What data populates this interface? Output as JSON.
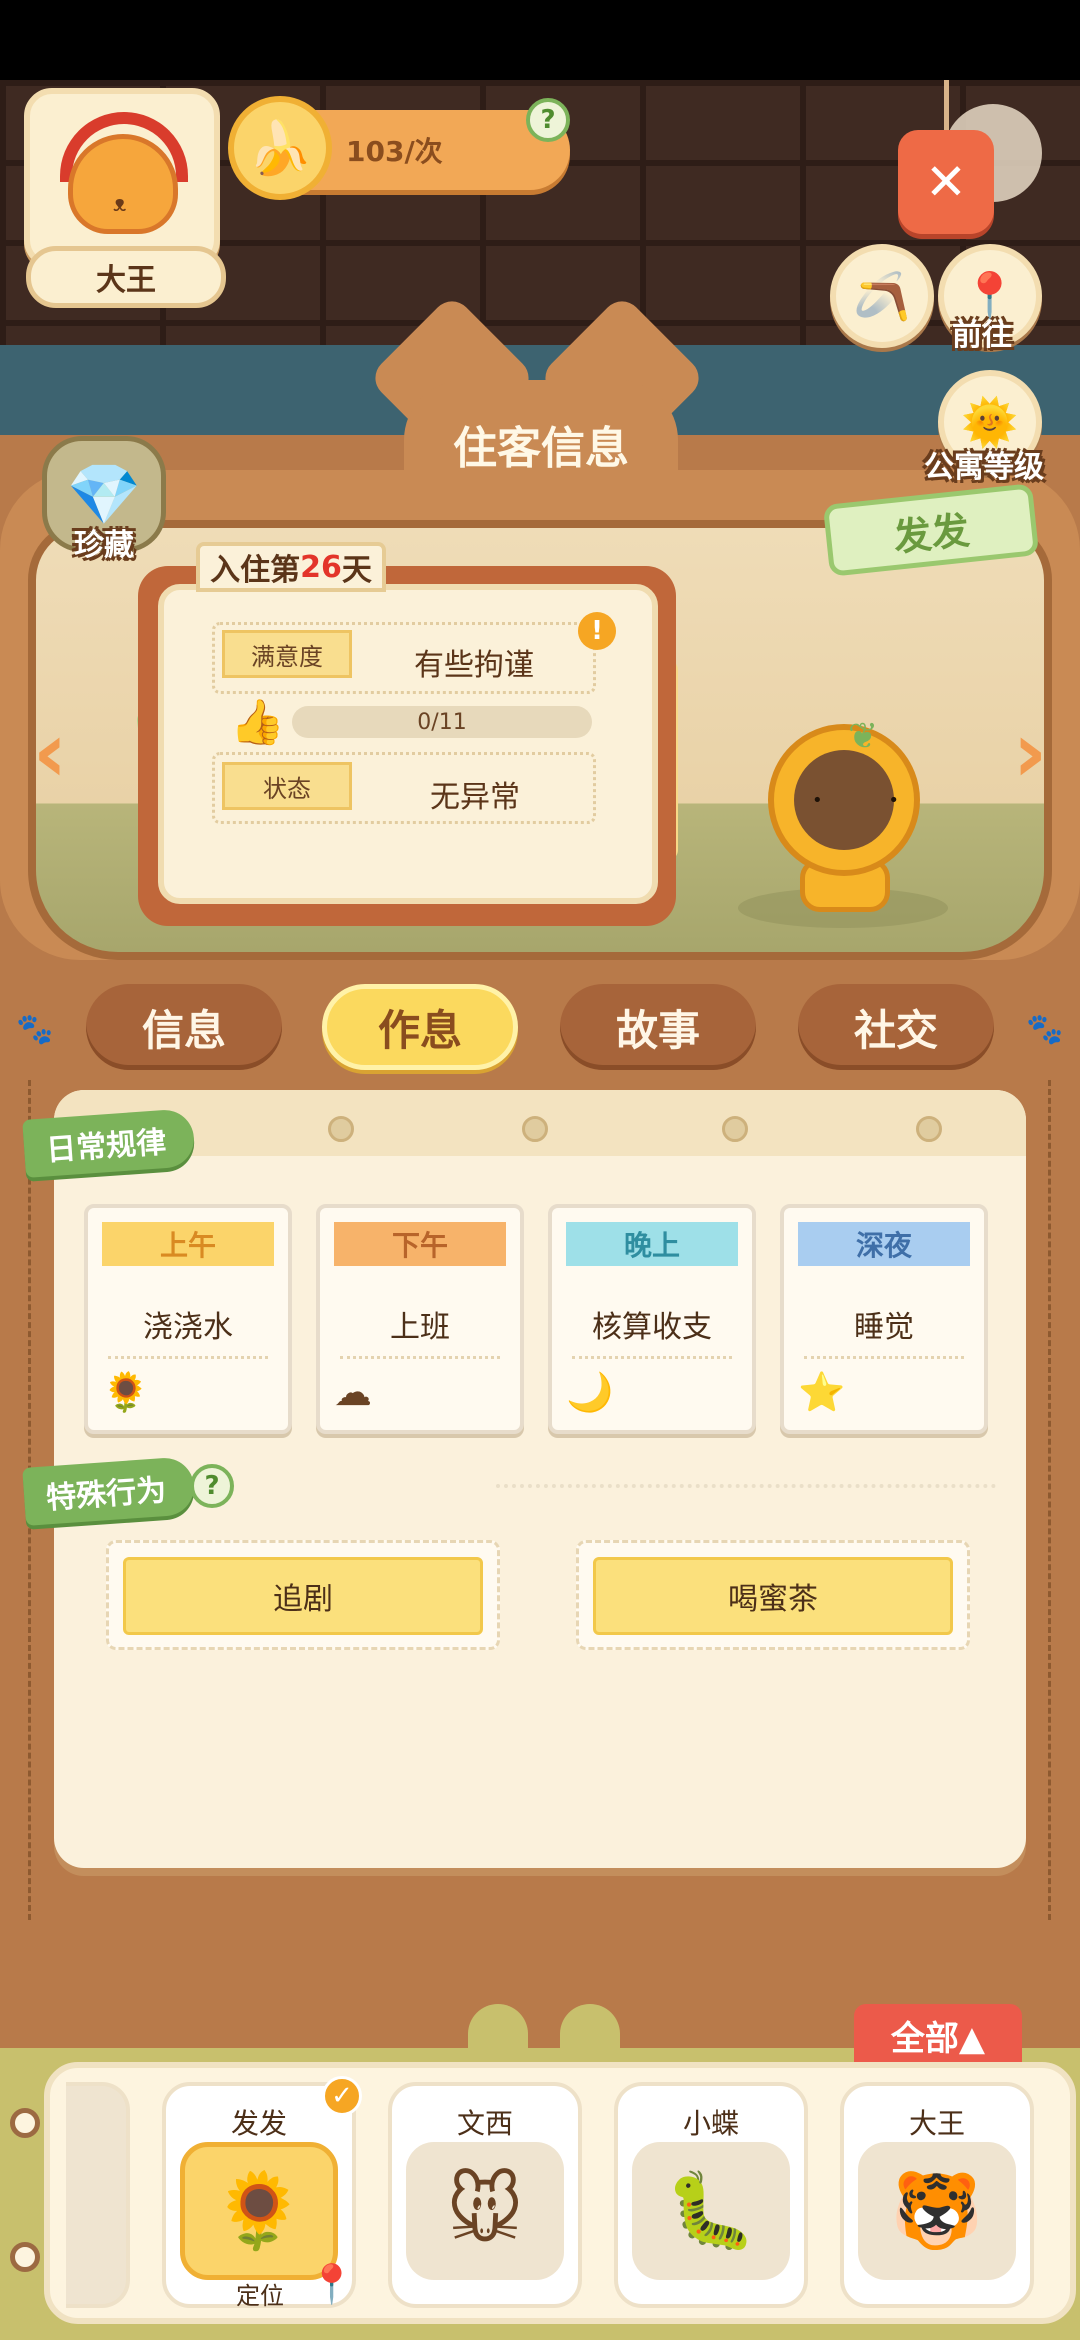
{
  "player": {
    "name": "大王",
    "banana_rate": "103/次",
    "help": "?"
  },
  "top_right": {
    "go_label": "前往",
    "apartment_level_label": "公寓等级",
    "send_label": "发发"
  },
  "panel": {
    "title": "住客信息",
    "treasure_label": "珍藏",
    "prev_arrow": "‹",
    "next_arrow": "›"
  },
  "resident": {
    "day_prefix": "入住第",
    "day_number": "26",
    "day_suffix": "天",
    "satisfaction_label": "满意度",
    "satisfaction_value": "有些拘谨",
    "progress_text": "0/11",
    "progress_value": 0,
    "status_label": "状态",
    "status_value": "无异常",
    "warning": "!"
  },
  "tabs": [
    {
      "label": "信息",
      "active": false
    },
    {
      "label": "作息",
      "active": true
    },
    {
      "label": "故事",
      "active": false
    },
    {
      "label": "社交",
      "active": false
    }
  ],
  "routine": {
    "section_label": "日常规律",
    "slots": [
      {
        "time": "上午",
        "activity": "浇浇水",
        "icon": "sun-icon",
        "time_bg": "#fbd46a",
        "time_color": "#d98a22"
      },
      {
        "time": "下午",
        "activity": "上班",
        "icon": "cloud-icon",
        "time_bg": "#f7b36a",
        "time_color": "#b8642a"
      },
      {
        "time": "晚上",
        "activity": "核算收支",
        "icon": "moon-icon",
        "time_bg": "#9ee0e8",
        "time_color": "#2f8ea0"
      },
      {
        "time": "深夜",
        "activity": "睡觉",
        "icon": "star-icon",
        "time_bg": "#a9cdf0",
        "time_color": "#3f6fa8"
      }
    ]
  },
  "special": {
    "section_label": "特殊行为",
    "help": "?",
    "items": [
      "追剧",
      "喝蜜茶"
    ]
  },
  "roster": {
    "all_label": "全部▲",
    "locate_label": "定位",
    "residents": [
      {
        "name": "发发",
        "selected": true
      },
      {
        "name": "文西",
        "selected": false
      },
      {
        "name": "小蝶",
        "selected": false
      },
      {
        "name": "大王",
        "selected": false
      }
    ]
  }
}
